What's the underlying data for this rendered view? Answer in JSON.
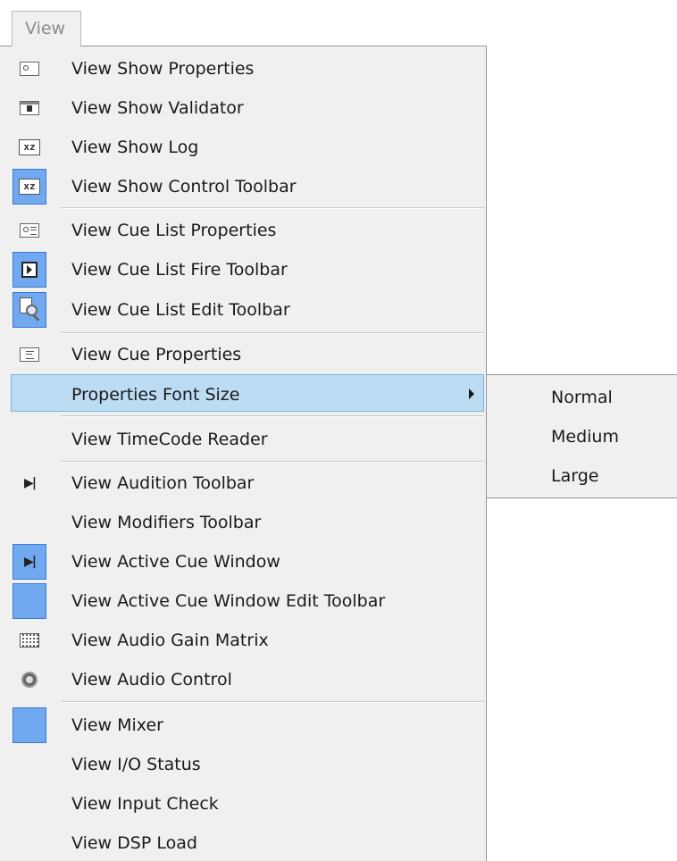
{
  "menu_bar": {
    "view_label": "View"
  },
  "menu": {
    "items": [
      {
        "label": "View Show Properties",
        "icon": "properties-icon"
      },
      {
        "label": "View Show Validator",
        "icon": "validator-icon"
      },
      {
        "label": "View Show Log",
        "icon": "log-icon"
      },
      {
        "label": "View Show Control Toolbar",
        "icon": "control-toolbar-icon",
        "checked": true
      },
      {
        "label": "View Cue List Properties",
        "icon": "cue-list-properties-icon"
      },
      {
        "label": "View Cue List Fire Toolbar",
        "icon": "fire-toolbar-icon",
        "checked": true
      },
      {
        "label": "View Cue List Edit Toolbar",
        "icon": "edit-toolbar-icon",
        "checked": true
      },
      {
        "label": "View Cue Properties",
        "icon": "cue-properties-icon"
      },
      {
        "label": "Properties Font Size",
        "highlighted": true,
        "has_submenu": true
      },
      {
        "label": "View TimeCode Reader"
      },
      {
        "label": "View Audition Toolbar",
        "icon": "skip-icon"
      },
      {
        "label": "View Modifiers Toolbar"
      },
      {
        "label": "View Active Cue Window",
        "icon": "skip-icon",
        "checked": true
      },
      {
        "label": "View Active Cue Window Edit Toolbar",
        "checked": true
      },
      {
        "label": "View Audio Gain Matrix",
        "icon": "matrix-icon"
      },
      {
        "label": "View Audio Control",
        "icon": "speaker-icon"
      },
      {
        "label": "View Mixer",
        "checked": true
      },
      {
        "label": "View I/O Status"
      },
      {
        "label": "View Input Check"
      },
      {
        "label": "View DSP Load"
      }
    ]
  },
  "submenu": {
    "items": [
      "Normal",
      "Medium",
      "Large"
    ]
  },
  "colors": {
    "menu_bg": "#f0f0f0",
    "highlight_bg": "#bcdcf4",
    "highlight_border": "#7ab3e0",
    "checked_bg": "#70a9ef"
  }
}
